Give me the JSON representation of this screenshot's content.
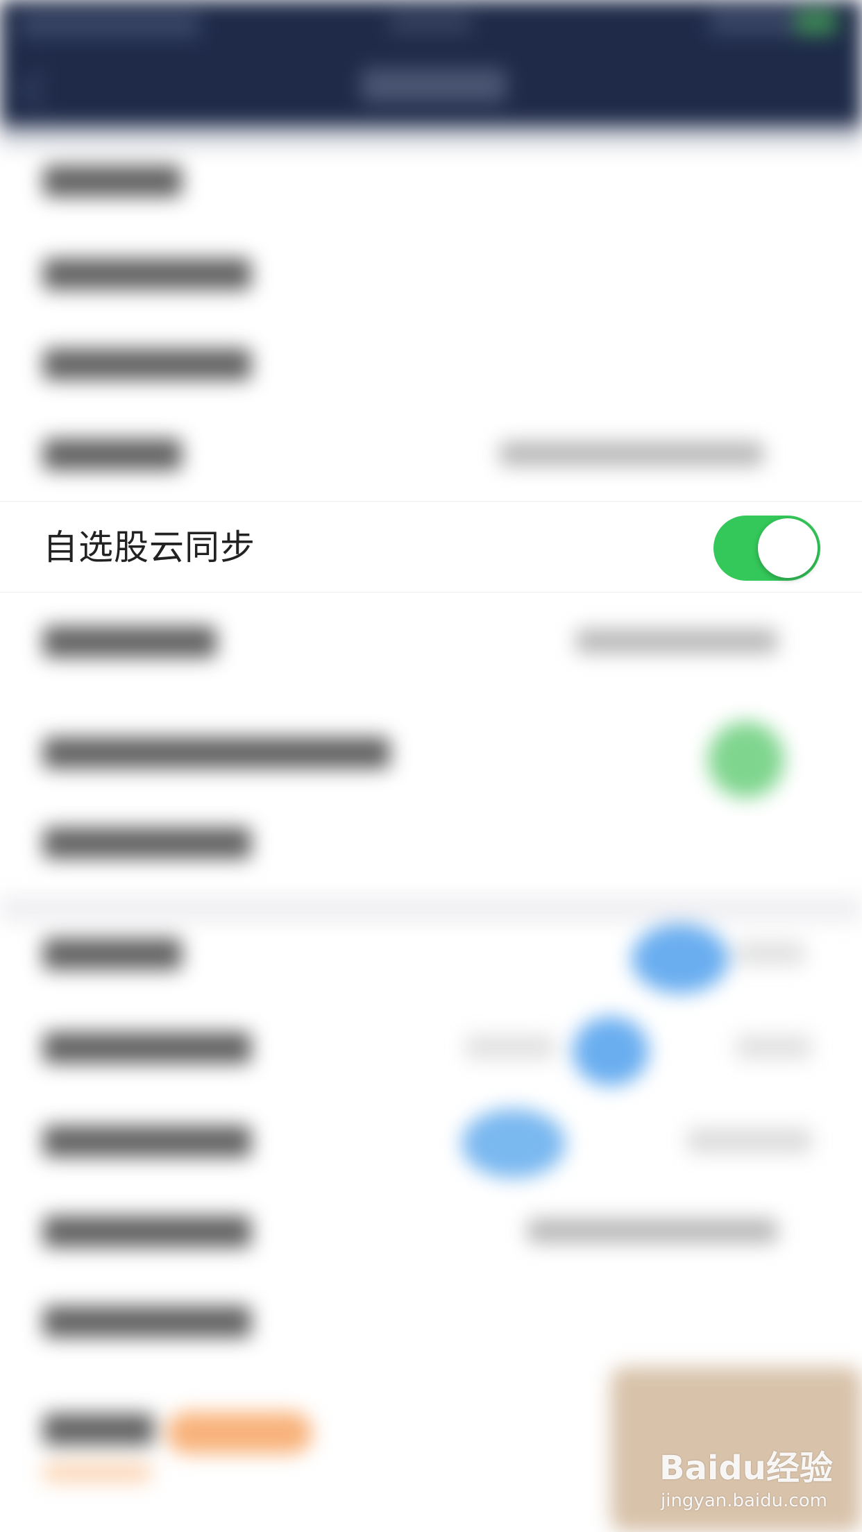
{
  "settings_row": {
    "label": "自选股云同步",
    "toggle_on": true,
    "toggle_color": "#34c759"
  },
  "watermark": {
    "logo": "Baidu经验",
    "url": "jingyan.baidu.com"
  },
  "colors": {
    "nav_bar": "#1e2a48",
    "accent_blue": "#6aaef0",
    "accent_orange": "#f8b27a",
    "background": "#ffffff"
  }
}
